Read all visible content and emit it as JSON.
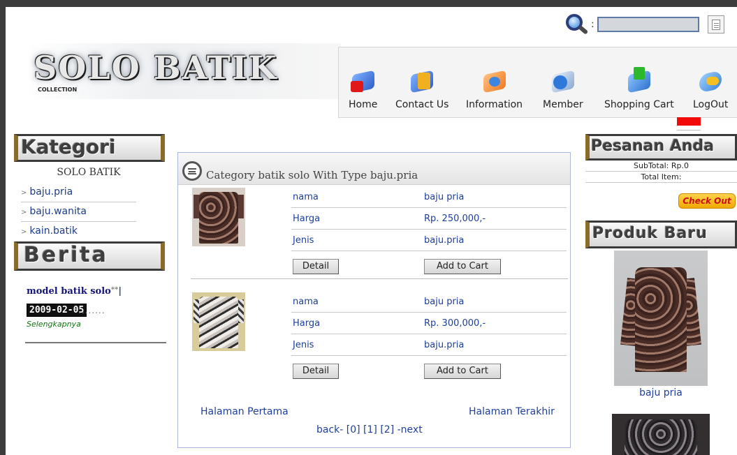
{
  "search": {
    "placeholder": ""
  },
  "logo": {
    "title": "SOLO BATIK",
    "subtitle": "COLLECTION"
  },
  "nav": {
    "items": [
      {
        "label": "Home",
        "icon": "home-icon"
      },
      {
        "label": "Contact Us",
        "icon": "contact-icon"
      },
      {
        "label": "Information",
        "icon": "information-icon"
      },
      {
        "label": "Member",
        "icon": "member-icon"
      },
      {
        "label": "Shopping Cart",
        "icon": "shopping-cart-icon"
      },
      {
        "label": "LogOut",
        "icon": "logout-icon"
      }
    ]
  },
  "left": {
    "kategori_header": "Kategori",
    "kategori_sub": "SOLO BATIK",
    "categories": [
      "baju.pria",
      "baju.wanita",
      "kain.batik"
    ],
    "berita_header": "Berita",
    "news": {
      "title": "model batik solo",
      "stars": "**",
      "date": "2009-02-05",
      "dots": "........",
      "more": "Selengkapnya"
    }
  },
  "main": {
    "title": "Category batik solo With Type baju.pria",
    "products": [
      {
        "nama_label": "nama",
        "nama": "baju pria",
        "harga_label": "Harga",
        "harga": "Rp. 250,000,-",
        "jenis_label": "Jenis",
        "jenis": "baju.pria",
        "detail": "Detail",
        "add": "Add to Cart"
      },
      {
        "nama_label": "nama",
        "nama": "baju pria",
        "harga_label": "Harga",
        "harga": "Rp. 300,000,-",
        "jenis_label": "Jenis",
        "jenis": "baju.pria",
        "detail": "Detail",
        "add": "Add to Cart"
      }
    ],
    "pager": {
      "first": "Halaman Pertama",
      "last": "Halaman Terakhir",
      "links": "back- [0] [1] [2] -next"
    }
  },
  "right": {
    "pesanan_header": "Pesanan Anda",
    "subtotal": "SubTotal: Rp.0",
    "total_item": "Total Item:",
    "checkout": "Check Out",
    "produk_header": "Produk Baru",
    "new_product": "baju pria"
  },
  "colors": {
    "accent_red": "#f20a0a",
    "link_blue": "#1f3f9a",
    "checkout_gold": "#f0a800"
  }
}
